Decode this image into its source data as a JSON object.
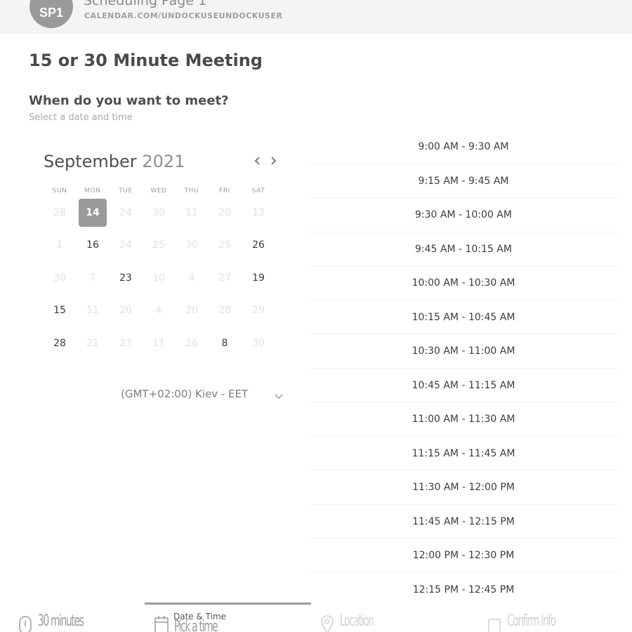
{
  "header": {
    "avatar_initials": "SP1",
    "title": "Scheduling Page 1",
    "url": "CALENDAR.COM/UNDOCKUSEUNDOCKUSER"
  },
  "meeting": {
    "title": "15 or 30 Minute Meeting",
    "question": "When do you want to meet?",
    "subtitle": "Select a date and time"
  },
  "calendar": {
    "month": "September",
    "year": "2021",
    "prev_icon": "chevron-left-icon",
    "next_icon": "chevron-right-icon",
    "weekdays": [
      "SUN",
      "MON",
      "TUE",
      "WED",
      "THU",
      "FRI",
      "SAT"
    ],
    "weeks": [
      [
        {
          "label": "28",
          "available": false
        },
        {
          "label": "14",
          "available": true,
          "selected": true
        },
        {
          "label": "24",
          "available": false
        },
        {
          "label": "30",
          "available": false
        },
        {
          "label": "11",
          "available": false
        },
        {
          "label": "20",
          "available": false
        },
        {
          "label": "13",
          "available": false
        }
      ],
      [
        {
          "label": "1",
          "available": false
        },
        {
          "label": "16",
          "available": true
        },
        {
          "label": "24",
          "available": false
        },
        {
          "label": "25",
          "available": false
        },
        {
          "label": "30",
          "available": false
        },
        {
          "label": "25",
          "available": false
        },
        {
          "label": "26",
          "available": true
        }
      ],
      [
        {
          "label": "30",
          "available": false
        },
        {
          "label": "7",
          "available": false
        },
        {
          "label": "23",
          "available": true
        },
        {
          "label": "10",
          "available": false
        },
        {
          "label": "4",
          "available": false
        },
        {
          "label": "27",
          "available": false
        },
        {
          "label": "19",
          "available": true
        }
      ],
      [
        {
          "label": "15",
          "available": true
        },
        {
          "label": "11",
          "available": false
        },
        {
          "label": "20",
          "available": false
        },
        {
          "label": "4",
          "available": false
        },
        {
          "label": "20",
          "available": false
        },
        {
          "label": "28",
          "available": false
        },
        {
          "label": "29",
          "available": false
        }
      ],
      [
        {
          "label": "28",
          "available": true
        },
        {
          "label": "21",
          "available": false
        },
        {
          "label": "23",
          "available": false
        },
        {
          "label": "11",
          "available": false
        },
        {
          "label": "26",
          "available": false
        },
        {
          "label": "8",
          "available": true
        },
        {
          "label": "30",
          "available": false
        }
      ]
    ]
  },
  "timezone": {
    "label": "(GMT+02:00) Kiev - EET",
    "icon": "chevron-down-icon"
  },
  "time_slots": [
    "9:00 AM - 9:30 AM",
    "9:15 AM - 9:45 AM",
    "9:30 AM - 10:00 AM",
    "9:45 AM - 10:15 AM",
    "10:00 AM - 10:30 AM",
    "10:15 AM - 10:45 AM",
    "10:30 AM - 11:00 AM",
    "10:45 AM - 11:15 AM",
    "11:00 AM - 11:30 AM",
    "11:15 AM - 11:45 AM",
    "11:30 AM - 12:00 PM",
    "11:45 AM - 12:15 PM",
    "12:00 PM - 12:30 PM",
    "12:15 PM - 12:45 PM"
  ],
  "steps": {
    "duration": {
      "label": "30 minutes",
      "icon": "clock-icon"
    },
    "datetime": {
      "label": "Date & Time",
      "value": "Pick a time",
      "icon": "calendar-icon",
      "active": true
    },
    "location": {
      "label": "Location",
      "icon": "location-pin-icon"
    },
    "confirm": {
      "label": "Confirm Info",
      "icon": "checkbox-icon"
    }
  },
  "colors": {
    "accent": "#9a9a9a",
    "text": "#333333",
    "muted": "#a9a9a9",
    "unavailable_day": "#e1e1e1",
    "header_bg": "#f4f4f4"
  }
}
